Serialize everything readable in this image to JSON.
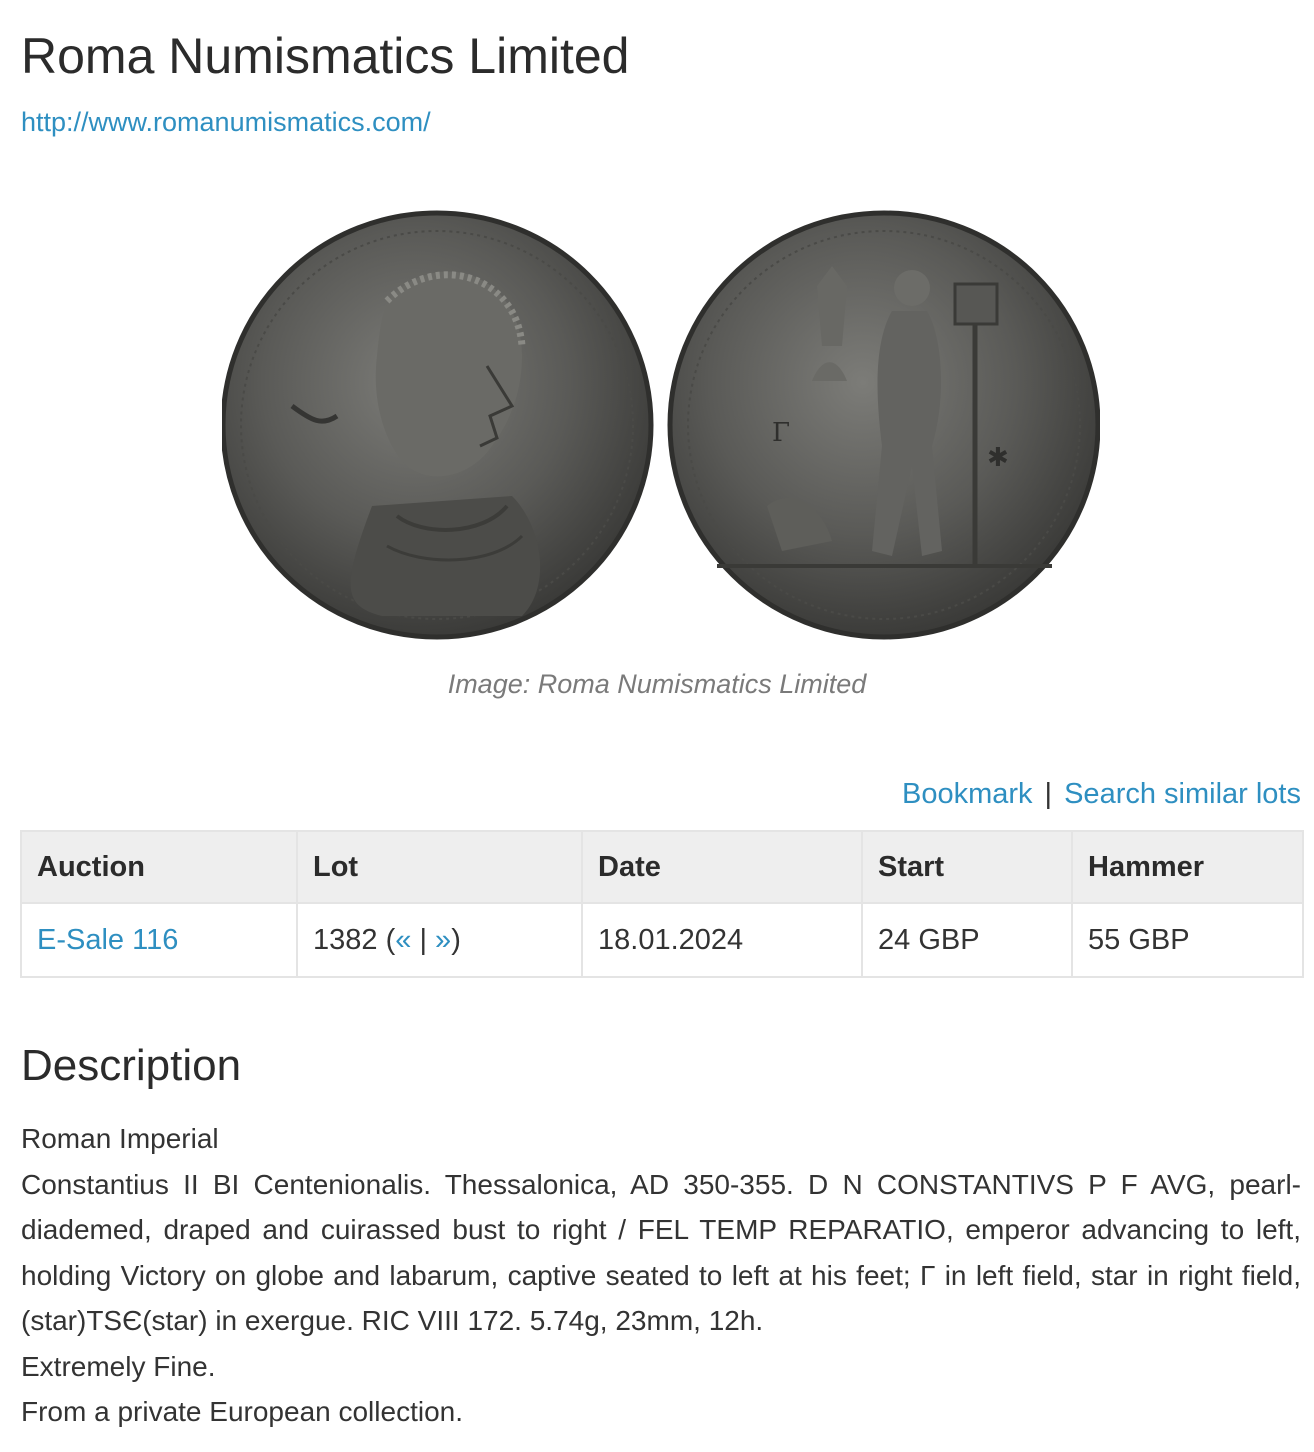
{
  "header": {
    "title": "Roma Numismatics Limited",
    "url": "http://www.romanumismatics.com/"
  },
  "image": {
    "caption": "Image: Roma Numismatics Limited"
  },
  "actions": {
    "bookmark": "Bookmark",
    "separator": "|",
    "search_similar": "Search similar lots"
  },
  "lot_table": {
    "headers": [
      "Auction",
      "Lot",
      "Date",
      "Start",
      "Hammer"
    ],
    "auction": "E-Sale 116",
    "lot_number": "1382",
    "prev": "«",
    "next": "»",
    "lot_sep": "|",
    "date": "18.01.2024",
    "start": "24 GBP",
    "hammer": "55 GBP"
  },
  "description": {
    "heading": "Description",
    "category": "Roman Imperial",
    "text": "Constantius II BI Centenionalis. Thessalonica, AD 350-355. D N CONSTANTIVS P F AVG, pearl-diademed, draped and cuirassed bust to right / FEL TEMP REPARATIO, emperor advancing to left, holding Victory on globe and labarum, captive seated to left at his feet; Γ in left field, star in right field, (star)TSЄ(star) in exergue. RIC VIII 172. 5.74g, 23mm, 12h.",
    "grade": "Extremely Fine.",
    "provenance": "From a private European collection."
  }
}
